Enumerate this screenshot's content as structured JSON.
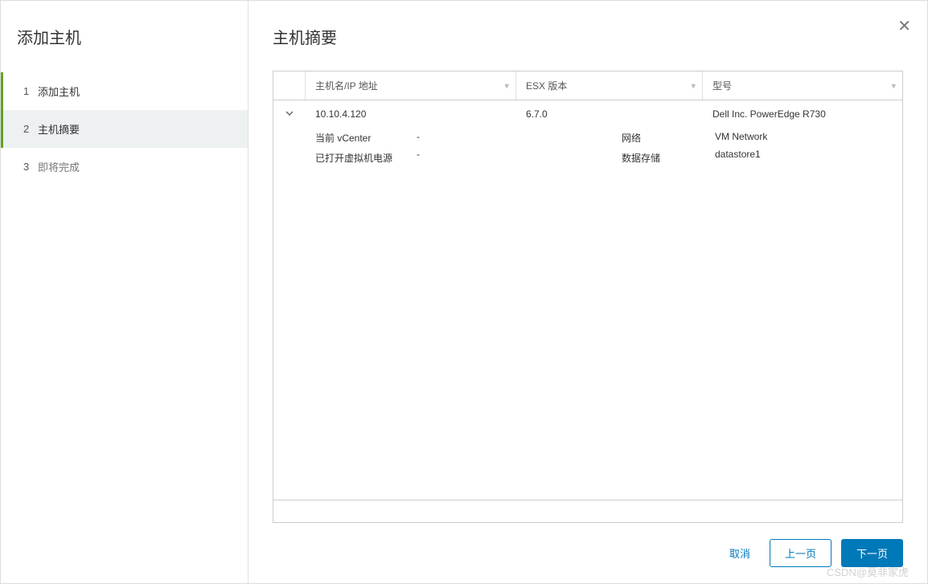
{
  "sidebar": {
    "title": "添加主机",
    "steps": [
      {
        "num": "1",
        "label": "添加主机"
      },
      {
        "num": "2",
        "label": "主机摘要"
      },
      {
        "num": "3",
        "label": "即将完成"
      }
    ]
  },
  "main": {
    "title": "主机摘要"
  },
  "table": {
    "columns": {
      "host": "主机名/IP 地址",
      "esx": "ESX 版本",
      "model": "型号"
    },
    "row": {
      "host": "10.10.4.120",
      "esx": "6.7.0",
      "model": "Dell Inc. PowerEdge R730"
    },
    "detail": {
      "vcenter_label": "当前 vCenter",
      "vcenter_value": "-",
      "poweredvm_label": "已打开虚拟机电源",
      "poweredvm_value": "-",
      "network_label": "网络",
      "network_value": "VM Network",
      "datastore_label": "数据存储",
      "datastore_value": "datastore1"
    }
  },
  "actions": {
    "cancel": "取消",
    "back": "上一页",
    "next": "下一页"
  },
  "watermark": "CSDN@莫非家虎"
}
